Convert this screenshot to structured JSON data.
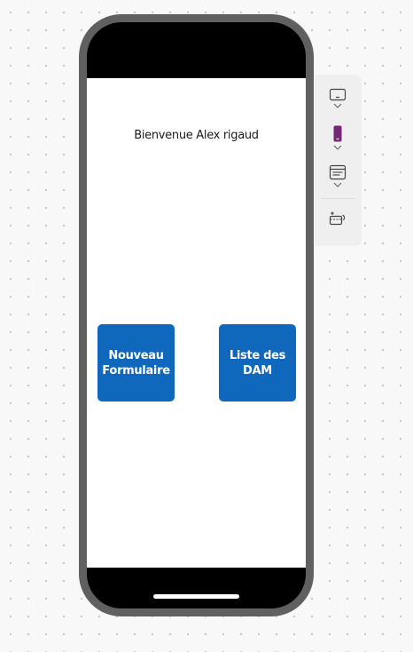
{
  "screen": {
    "welcome_text": "Bienvenue Alex rigaud",
    "tiles": [
      {
        "line1": "Nouveau",
        "line2": "Formulaire"
      },
      {
        "line1": "Liste des",
        "line2": "DAM"
      }
    ]
  },
  "side_panel": {
    "items": [
      {
        "icon": "tablet-landscape-icon",
        "has_dropdown": true
      },
      {
        "icon": "phone-portrait-icon",
        "has_dropdown": true,
        "color": "#742774"
      },
      {
        "icon": "layout-icon",
        "has_dropdown": true
      },
      {
        "icon": "fit-to-screen-icon",
        "has_dropdown": false
      }
    ]
  },
  "colors": {
    "tile": "#1068bd",
    "phone_frame": "#606060",
    "device_accent": "#742774"
  }
}
